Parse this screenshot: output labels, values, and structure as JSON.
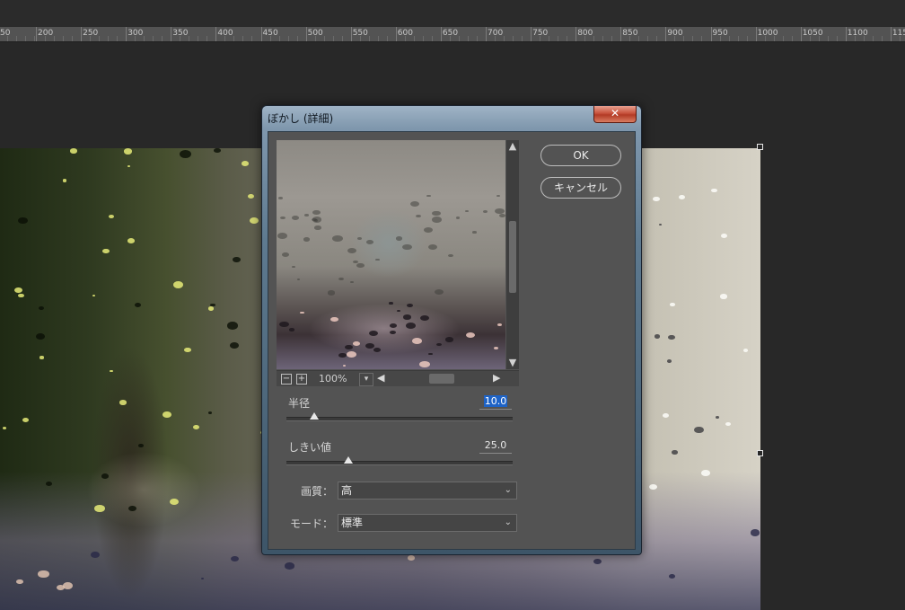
{
  "ruler": {
    "labels": [
      "50",
      "200",
      "250",
      "300",
      "350",
      "400",
      "450",
      "500",
      "550",
      "600",
      "650",
      "700",
      "750",
      "800",
      "850",
      "900",
      "950",
      "1000",
      "1050",
      "1100",
      "115"
    ]
  },
  "dialog": {
    "title": "ぼかし (詳細)",
    "close_symbol": "✕",
    "preview": {
      "zoom_out": "−",
      "zoom_in": "+",
      "zoom_level": "100%",
      "zoom_dropdown": "▾",
      "scroll_up": "▲",
      "scroll_down": "▼",
      "scroll_left": "◀",
      "scroll_right": "▶"
    },
    "ok_label": "OK",
    "cancel_label": "キャンセル",
    "radius": {
      "label": "半径",
      "value": "10.0",
      "level": 0.1
    },
    "threshold": {
      "label": "しきい値",
      "value": "25.0",
      "level": 0.25
    },
    "quality": {
      "label": "画質：",
      "value": "高"
    },
    "mode": {
      "label": "モード：",
      "value": "標準"
    },
    "chevron": "⌄"
  },
  "colors": {
    "accent_selection": "#1e63c6",
    "close_button": "#c8523c",
    "panel": "#535353"
  }
}
